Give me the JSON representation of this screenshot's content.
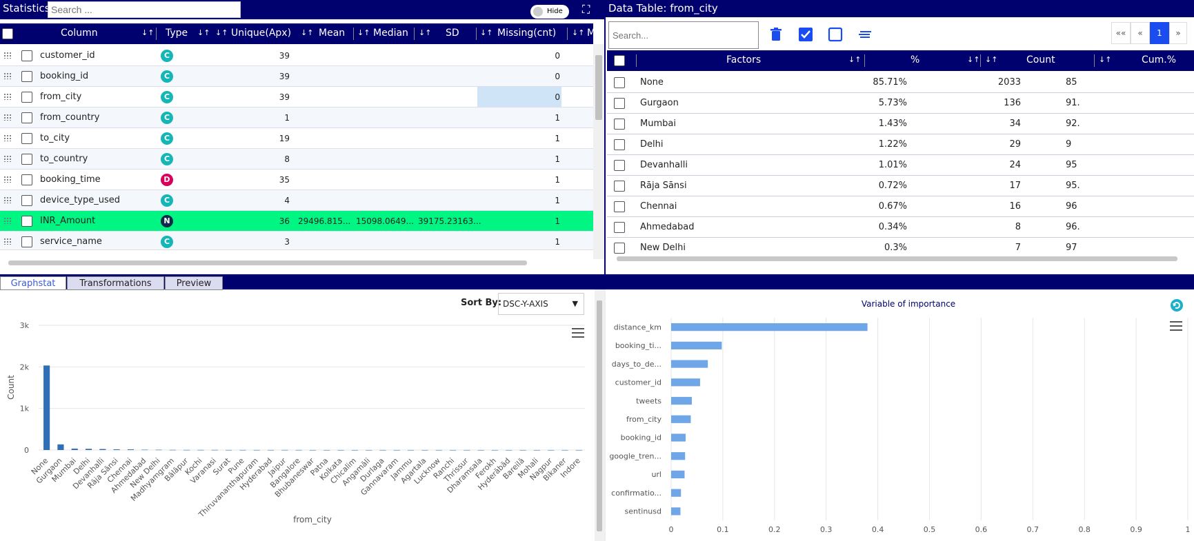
{
  "stats": {
    "title": "Statistics",
    "search_placeholder": "Search ...",
    "hide_label": "Hide",
    "columns": [
      "Column",
      "Type",
      "Unique(Apx)",
      "Mean",
      "Median",
      "SD",
      "Missing(cnt)",
      "Mi"
    ],
    "rows": [
      {
        "name": "customer_id",
        "type": "C",
        "unique": "39",
        "mean": "",
        "median": "",
        "sd": "",
        "missing": "0"
      },
      {
        "name": "booking_id",
        "type": "C",
        "unique": "39",
        "mean": "",
        "median": "",
        "sd": "",
        "missing": "0"
      },
      {
        "name": "from_city",
        "type": "C",
        "unique": "39",
        "mean": "",
        "median": "",
        "sd": "",
        "missing": "0"
      },
      {
        "name": "from_country",
        "type": "C",
        "unique": "1",
        "mean": "",
        "median": "",
        "sd": "",
        "missing": "1"
      },
      {
        "name": "to_city",
        "type": "C",
        "unique": "19",
        "mean": "",
        "median": "",
        "sd": "",
        "missing": "1"
      },
      {
        "name": "to_country",
        "type": "C",
        "unique": "8",
        "mean": "",
        "median": "",
        "sd": "",
        "missing": "1"
      },
      {
        "name": "booking_time",
        "type": "D",
        "unique": "35",
        "mean": "",
        "median": "",
        "sd": "",
        "missing": "1"
      },
      {
        "name": "device_type_used",
        "type": "C",
        "unique": "4",
        "mean": "",
        "median": "",
        "sd": "",
        "missing": "1"
      },
      {
        "name": "INR_Amount",
        "type": "N",
        "unique": "36",
        "mean": "29496.815...",
        "median": "15098.0649...",
        "sd": "39175.23163...",
        "missing": "1"
      },
      {
        "name": "service_name",
        "type": "C",
        "unique": "3",
        "mean": "",
        "median": "",
        "sd": "",
        "missing": "1"
      }
    ]
  },
  "data_table": {
    "title": "Data Table: from_city",
    "search_placeholder": "Search...",
    "columns": [
      "Factors",
      "%",
      "Count",
      "Cum.%"
    ],
    "pagination": {
      "first": "«« ",
      "prev": "«",
      "current": "1",
      "next": "»"
    },
    "rows": [
      {
        "factor": "None",
        "pct": "85.71%",
        "count": "2033",
        "cum": "85"
      },
      {
        "factor": "Gurgaon",
        "pct": "5.73%",
        "count": "136",
        "cum": "91."
      },
      {
        "factor": "Mumbai",
        "pct": "1.43%",
        "count": "34",
        "cum": "92."
      },
      {
        "factor": "Delhi",
        "pct": "1.22%",
        "count": "29",
        "cum": "9"
      },
      {
        "factor": "Devanhalli",
        "pct": "1.01%",
        "count": "24",
        "cum": "95"
      },
      {
        "factor": "Rāja Sānsi",
        "pct": "0.72%",
        "count": "17",
        "cum": "95."
      },
      {
        "factor": "Chennai",
        "pct": "0.67%",
        "count": "16",
        "cum": "96"
      },
      {
        "factor": "Ahmedabad",
        "pct": "0.34%",
        "count": "8",
        "cum": "96."
      },
      {
        "factor": "New Delhi",
        "pct": "0.3%",
        "count": "7",
        "cum": "97"
      }
    ]
  },
  "tabs": [
    "Graphstat",
    "Transformations",
    "Preview"
  ],
  "sort": {
    "label": "Sort By:",
    "value": "DSC-Y-AXIS"
  },
  "chart_data": [
    {
      "type": "bar",
      "title": "",
      "xlabel": "from_city",
      "ylabel": "Count",
      "ylim": [
        0,
        3000
      ],
      "yticks": [
        "0",
        "1k",
        "2k",
        "3k"
      ],
      "categories": [
        "None",
        "Gurgaon",
        "Mumbai",
        "Delhi",
        "Devanhalli",
        "Rāja Sānsi",
        "Chennai",
        "Ahmedabad",
        "New Delhi",
        "Madhyamgram",
        "Bālāpur",
        "Kochi",
        "Varanasi",
        "Surat",
        "Pune",
        "Thiruvananthapuram",
        "Hyderabad",
        "Jaipur",
        "Bangalore",
        "Bhubaneswar",
        "Patna",
        "Kolkata",
        "Chicalim",
        "Angamāli",
        "Durlaga",
        "Gannavaram",
        "Jammu",
        "Agartala",
        "Lucknow",
        "Ranchi",
        "Thrissur",
        "Dharamsala",
        "Ferokh",
        "Hyderābād",
        "Bareilā",
        "Mohali",
        "Nagpur",
        "Bikaner",
        "Indore"
      ],
      "values": [
        2033,
        136,
        34,
        29,
        24,
        17,
        16,
        8,
        7,
        4,
        3,
        3,
        3,
        2,
        2,
        2,
        2,
        2,
        2,
        1,
        1,
        1,
        1,
        1,
        1,
        1,
        1,
        1,
        1,
        1,
        1,
        1,
        1,
        1,
        1,
        1,
        1,
        1,
        1
      ],
      "grid": true
    },
    {
      "type": "bar",
      "orientation": "horizontal",
      "title": "Variable of importance",
      "xlim": [
        0,
        1
      ],
      "xticks": [
        "0",
        "0.1",
        "0.2",
        "0.3",
        "0.4",
        "0.5",
        "0.6",
        "0.7",
        "0.8",
        "0.9",
        "1"
      ],
      "categories": [
        "distance_km",
        "booking_ti...",
        "days_to_de...",
        "customer_id",
        "tweets",
        "from_city",
        "booking_id",
        "google_tren...",
        "url",
        "confirmatio...",
        "sentinusd"
      ],
      "values": [
        0.38,
        0.098,
        0.071,
        0.056,
        0.04,
        0.038,
        0.028,
        0.027,
        0.026,
        0.019,
        0.018
      ],
      "grid": true,
      "bar_color": "#6ea6e8"
    }
  ],
  "colors": {
    "navy": "#00006e",
    "highlight": "#00f583",
    "badge_c": "#17b6b6",
    "badge_d": "#d8005a",
    "badge_n": "#0c2b4b",
    "accent": "#1a4cf0"
  }
}
